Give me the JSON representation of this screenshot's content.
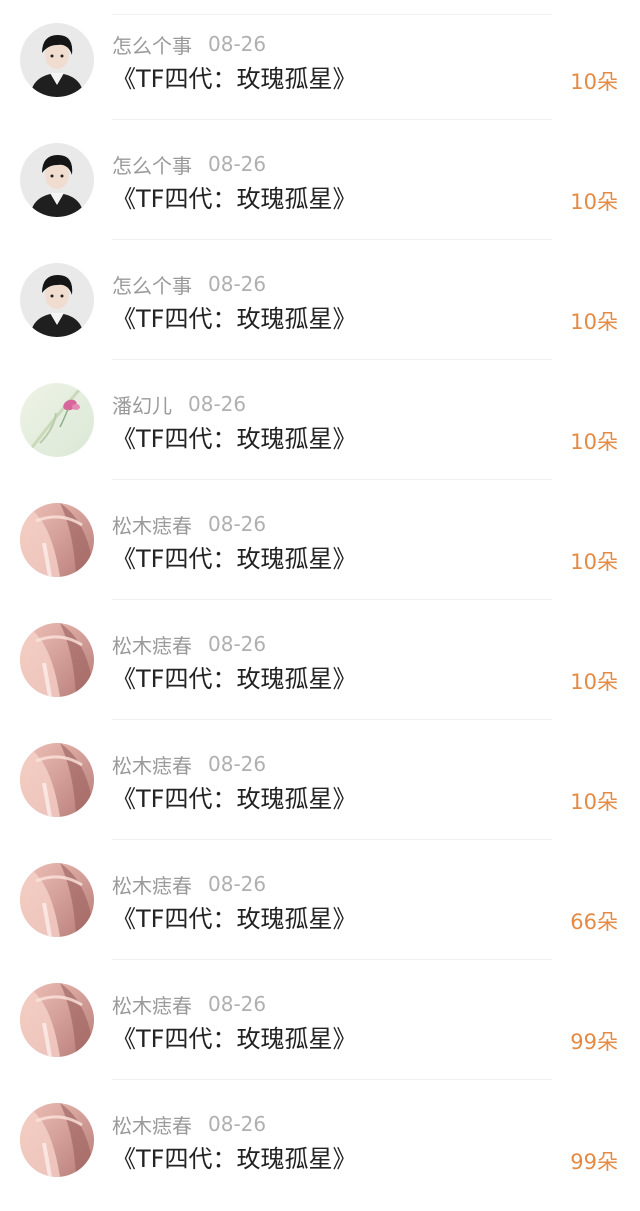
{
  "colors": {
    "username": "#9a9a9a",
    "date": "#b0b0b0",
    "title": "#222222",
    "gift": "#e58a43"
  },
  "rows": [
    {
      "user": "怎么个事",
      "date": "08-26",
      "title": "《TF四代：玫瑰孤星》",
      "gift": "10朵",
      "avatar": "boy-avatar-icon"
    },
    {
      "user": "怎么个事",
      "date": "08-26",
      "title": "《TF四代：玫瑰孤星》",
      "gift": "10朵",
      "avatar": "boy-avatar-icon"
    },
    {
      "user": "怎么个事",
      "date": "08-26",
      "title": "《TF四代：玫瑰孤星》",
      "gift": "10朵",
      "avatar": "boy-avatar-icon"
    },
    {
      "user": "潘幻儿",
      "date": "08-26",
      "title": "《TF四代：玫瑰孤星》",
      "gift": "10朵",
      "avatar": "flower-avatar-icon"
    },
    {
      "user": "松木痣春",
      "date": "08-26",
      "title": "《TF四代：玫瑰孤星》",
      "gift": "10朵",
      "avatar": "pink-hair-avatar-icon"
    },
    {
      "user": "松木痣春",
      "date": "08-26",
      "title": "《TF四代：玫瑰孤星》",
      "gift": "10朵",
      "avatar": "pink-hair-avatar-icon"
    },
    {
      "user": "松木痣春",
      "date": "08-26",
      "title": "《TF四代：玫瑰孤星》",
      "gift": "10朵",
      "avatar": "pink-hair-avatar-icon"
    },
    {
      "user": "松木痣春",
      "date": "08-26",
      "title": "《TF四代：玫瑰孤星》",
      "gift": "66朵",
      "avatar": "pink-hair-avatar-icon"
    },
    {
      "user": "松木痣春",
      "date": "08-26",
      "title": "《TF四代：玫瑰孤星》",
      "gift": "99朵",
      "avatar": "pink-hair-avatar-icon"
    },
    {
      "user": "松木痣春",
      "date": "08-26",
      "title": "《TF四代：玫瑰孤星》",
      "gift": "99朵",
      "avatar": "pink-hair-avatar-icon"
    }
  ]
}
